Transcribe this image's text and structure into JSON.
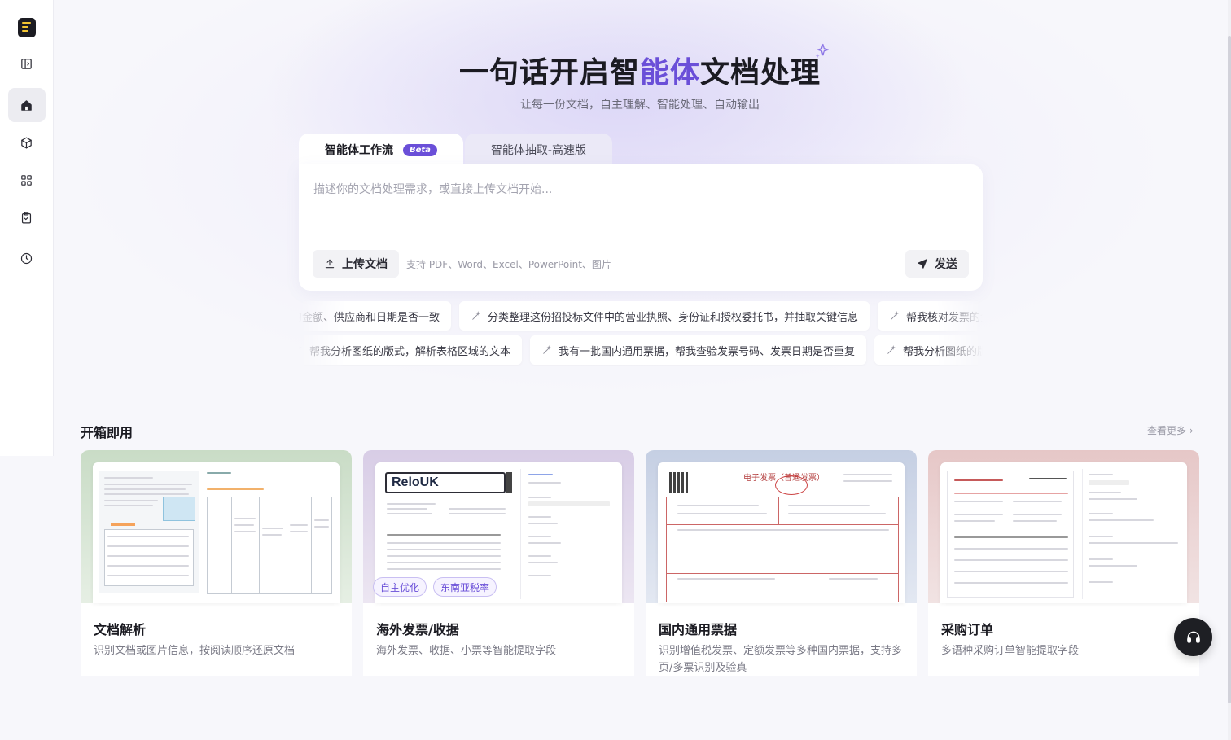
{
  "hero": {
    "title_part1": "一句话开启智",
    "title_accent": "能体",
    "title_part2": "文档处理",
    "subtitle": "让每一份文档，自主理解、智能处理、自动输出"
  },
  "tabs": [
    {
      "label": "智能体工作流",
      "badge": "Beta"
    },
    {
      "label": "智能体抽取-高速版"
    }
  ],
  "composer": {
    "placeholder": "描述你的文档处理需求，或直接上传文档开始...",
    "upload_label": "上传文档",
    "hint": "支持 PDF、Word、Excel、PowerPoint、图片",
    "send_label": "发送"
  },
  "suggestions_row1": [
    "帮我核对发票的金额、供应商和日期是否一致",
    "分类整理这份招投标文件中的营业执照、身份证和授权委托书，并抽取关键信息",
    "帮我核对发票的金额、供应商和日期是否一致"
  ],
  "suggestions_row2": [
    "帮我分析图纸的版式，解析表格区域的文本",
    "我有一批国内通用票据，帮我查验发票号码、发票日期是否重复",
    "帮我分析图纸的版式，解析表格区域的文本"
  ],
  "section": {
    "title": "开箱即用",
    "more": "查看更多 ›"
  },
  "cards": [
    {
      "title": "文档解析",
      "desc": "识别文档或图片信息，按阅读顺序还原文档",
      "bg": "#c9dcc6"
    },
    {
      "title": "海外发票/收据",
      "desc": "海外发票、收据、小票等智能提取字段",
      "bg": "#d8cde6",
      "tags": [
        "自主优化",
        "东南亚税率"
      ],
      "logo": "ReloUK"
    },
    {
      "title": "国内通用票据",
      "desc": "识别增值税发票、定额发票等多种国内票据，支持多页/多票识别及验真",
      "bg": "#c5cfe3",
      "doc_title": "电子发票（普通发票）"
    },
    {
      "title": "采购订单",
      "desc": "多语种采购订单智能提取字段",
      "bg": "#e6c7c7"
    }
  ],
  "colors": {
    "accent": "#6a4fd8",
    "text": "#1b1b22"
  }
}
